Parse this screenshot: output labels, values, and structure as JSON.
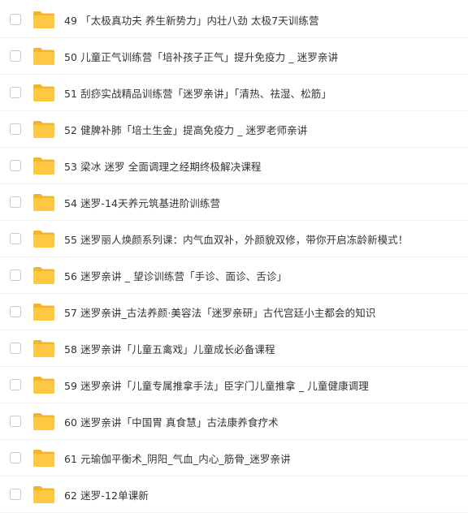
{
  "colors": {
    "folder_body": "#FFC843",
    "folder_back": "#F5B52A",
    "text": "#333333",
    "checkbox_border": "#c9c9c9"
  },
  "files": [
    {
      "name": "49 「太极真功夫 养生新势力」内壮八劲 太极7天训练营",
      "icon": "folder-icon"
    },
    {
      "name": "50 儿童正气训练营「培补孩子正气」提升免疫力 _ 迷罗亲讲",
      "icon": "folder-icon"
    },
    {
      "name": "51 刮痧实战精品训练营「迷罗亲讲」「清热、祛湿、松筋」",
      "icon": "folder-icon"
    },
    {
      "name": "52 健脾补肺「培土生金」提高免疫力 _ 迷罗老师亲讲",
      "icon": "folder-icon"
    },
    {
      "name": "53 梁冰 迷罗 全面调理之经期终极解决课程",
      "icon": "folder-icon"
    },
    {
      "name": "54 迷罗-14天养元筑基进阶训练营",
      "icon": "folder-icon"
    },
    {
      "name": "55 迷罗丽人焕颜系列课：内气血双补，外颜貌双修，带你开启冻龄新模式！",
      "icon": "folder-icon"
    },
    {
      "name": "56 迷罗亲讲 _ 望诊训练营「手诊、面诊、舌诊」",
      "icon": "folder-icon"
    },
    {
      "name": "57 迷罗亲讲_古法养颜·美容法「迷罗亲研」古代宫廷小主都会的知识",
      "icon": "folder-icon"
    },
    {
      "name": "58 迷罗亲讲「儿童五禽戏」儿童成长必备课程",
      "icon": "folder-icon"
    },
    {
      "name": "59 迷罗亲讲「儿童专属推拿手法」臣字门儿童推拿 _ 儿童健康调理",
      "icon": "folder-icon"
    },
    {
      "name": "60 迷罗亲讲「中国胃 真食慧」古法康养食疗术",
      "icon": "folder-icon"
    },
    {
      "name": "61 元瑜伽平衡术_阴阳_气血_内心_筋骨_迷罗亲讲",
      "icon": "folder-icon"
    },
    {
      "name": "62 迷罗-12单课新",
      "icon": "folder-icon"
    }
  ]
}
